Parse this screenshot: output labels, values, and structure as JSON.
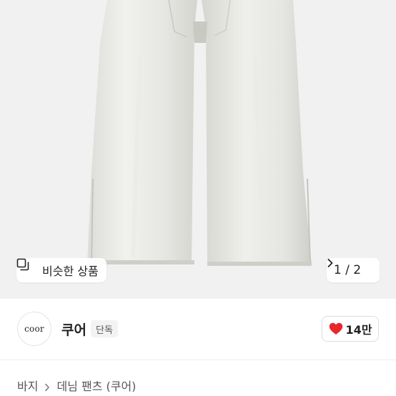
{
  "product_image": {
    "similar_label": "비슷한 상품",
    "pager": {
      "current": "1",
      "total": "2",
      "separator": " / "
    },
    "icons": {
      "similar": "copy-icon",
      "next": "chevron-right-icon"
    }
  },
  "shop": {
    "logo_text": "coor",
    "name": "쿠어",
    "badge": "단독",
    "likes": "14만",
    "like_icon": "heart-icon",
    "like_color": "#e8262c"
  },
  "breadcrumb": {
    "items": [
      "바지",
      "데님 팬츠 (쿠어)"
    ],
    "separator_icon": "chevron-right-icon"
  }
}
